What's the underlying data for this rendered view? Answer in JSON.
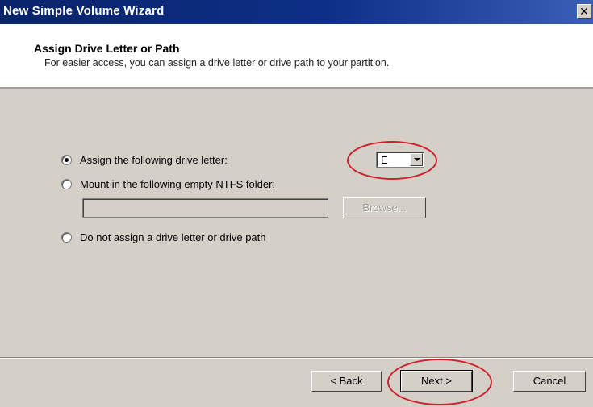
{
  "window": {
    "title": "New Simple Volume Wizard",
    "close_glyph": "✕"
  },
  "header": {
    "title": "Assign Drive Letter or Path",
    "subtitle": "For easier access, you can assign a drive letter or drive path to your partition."
  },
  "options": {
    "assign_letter": {
      "label": "Assign the following drive letter:",
      "checked": true
    },
    "mount_folder": {
      "label": "Mount in the following empty NTFS folder:",
      "checked": false
    },
    "no_assign": {
      "label": "Do not assign a drive letter or drive path",
      "checked": false
    }
  },
  "drive_letter": {
    "value": "E"
  },
  "folder_path": {
    "value": ""
  },
  "buttons": {
    "browse": "Browse...",
    "back": "< Back",
    "next": "Next >",
    "cancel": "Cancel"
  },
  "colors": {
    "title_bar": "#0a246a",
    "dialog_face": "#d4d0c8",
    "callout": "#d0202a"
  }
}
